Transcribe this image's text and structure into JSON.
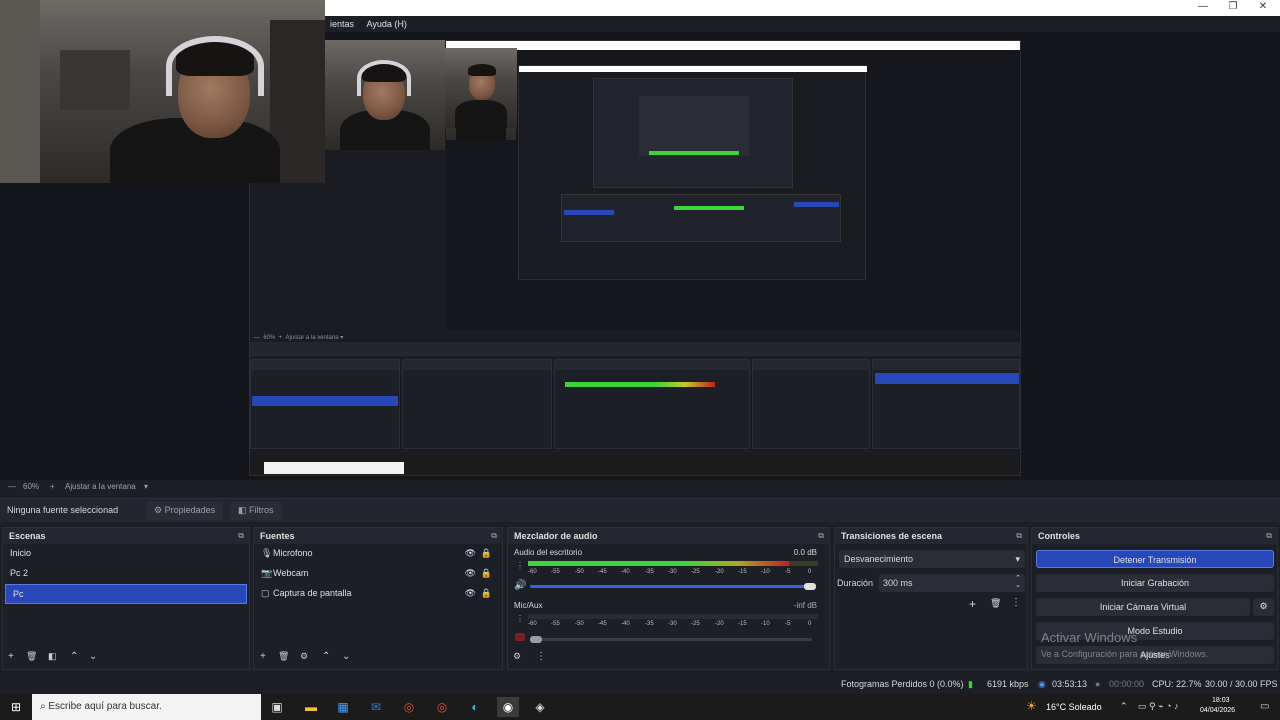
{
  "menubar": {
    "items": [
      "ientas",
      "Ayuda (H)"
    ]
  },
  "window_controls": {
    "minimize": "—",
    "maximize": "❐",
    "close": "✕"
  },
  "zoom": {
    "level": "60%",
    "fit": "Ajustar a la ventana"
  },
  "toolbar": {
    "no_source": "Ninguna fuente seleccionad",
    "properties": "Propiedades",
    "filters": "Filtros"
  },
  "scenes": {
    "title": "Escenas",
    "items": [
      {
        "label": "Inicio",
        "selected": false
      },
      {
        "label": "Pc 2",
        "selected": false
      },
      {
        "label": "Pc",
        "selected": true
      }
    ]
  },
  "sources": {
    "title": "Fuentes",
    "items": [
      {
        "label": "Microfono",
        "icon": "microphone-icon"
      },
      {
        "label": "Webcam",
        "icon": "camera-icon"
      },
      {
        "label": "Captura de pantalla",
        "icon": "monitor-icon"
      }
    ]
  },
  "mixer": {
    "title": "Mezclador de audio",
    "channels": [
      {
        "name": "Audio del escritorio",
        "db": "0.0 dB",
        "level": 0.9
      },
      {
        "name": "Mic/Aux",
        "db": "-inf dB",
        "level": 0
      }
    ],
    "ticks": [
      "-60",
      "-55",
      "-50",
      "-45",
      "-40",
      "-35",
      "-30",
      "-25",
      "-20",
      "-15",
      "-10",
      "-5",
      "0"
    ]
  },
  "transitions": {
    "title": "Transiciones de escena",
    "selected": "Desvanecimiento",
    "duration_label": "Duración",
    "duration_value": "300 ms"
  },
  "controls": {
    "title": "Controles",
    "stop_stream": "Detener Transmisión",
    "start_recording": "Iniciar Grabación",
    "start_virtual_cam": "Iniciar Cámara Virtual",
    "studio_mode": "Modo Estudio",
    "settings": "Ajustes"
  },
  "statusbar": {
    "dropped_frames": "Fotogramas Perdidos 0 (0.0%)",
    "bitrate": "6191 kbps",
    "stream_time": "03:53:13",
    "rec_time": "00:00:00",
    "cpu": "CPU: 22.7%",
    "fps": "30.00 / 30.00 FPS"
  },
  "taskbar": {
    "search_placeholder": "Escribe aquí para buscar.",
    "weather": "16°C  Soleado",
    "time": "18:03",
    "date": "04/04/2026"
  },
  "watermark": {
    "title": "Activar Windows",
    "subtitle": "Ve a Configuración para activar Windows."
  },
  "colors": {
    "accent_blue": "#2847b8",
    "meter_green": "#3bd43b",
    "meter_yellow": "#c8c82a",
    "meter_red": "#c02222"
  }
}
